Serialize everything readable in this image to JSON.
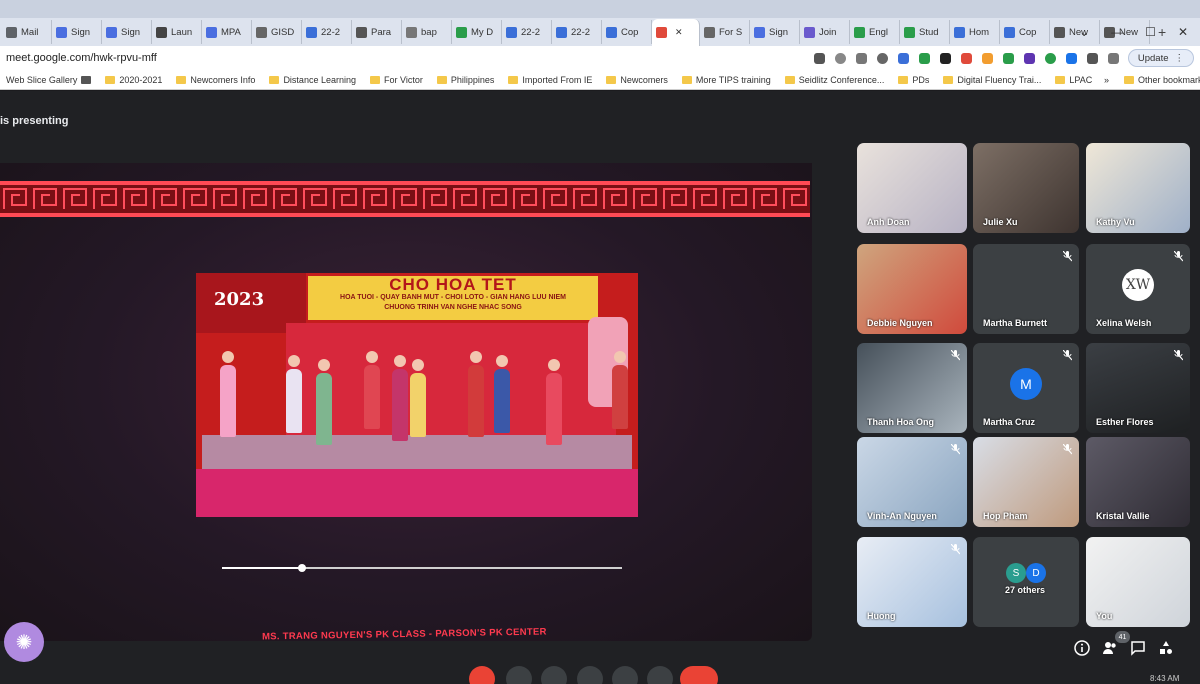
{
  "browser": {
    "tabs": [
      {
        "label": "Mail",
        "color": "#5f6368"
      },
      {
        "label": "Sign",
        "color": "#4a6ee0"
      },
      {
        "label": "Sign",
        "color": "#4a6ee0"
      },
      {
        "label": "Laun",
        "color": "#444444"
      },
      {
        "label": "MPA",
        "color": "#4a6ee0"
      },
      {
        "label": "GISD",
        "color": "#666666"
      },
      {
        "label": "22-2",
        "color": "#3b6fd8"
      },
      {
        "label": "Para",
        "color": "#555555"
      },
      {
        "label": "bap",
        "color": "#777777"
      },
      {
        "label": "My D",
        "color": "#2a9d4a"
      },
      {
        "label": "22-2",
        "color": "#3b6fd8"
      },
      {
        "label": "22-2",
        "color": "#3b6fd8"
      },
      {
        "label": "Cop",
        "color": "#3b6fd8"
      },
      {
        "label": "",
        "color": "#e04a3b"
      },
      {
        "label": "For S",
        "color": "#666666"
      },
      {
        "label": "Sign",
        "color": "#4a6ee0"
      },
      {
        "label": "Join",
        "color": "#6a5acd"
      },
      {
        "label": "Engl",
        "color": "#2a9d4a"
      },
      {
        "label": "Stud",
        "color": "#2a9d4a"
      },
      {
        "label": "Hom",
        "color": "#3b6fd8"
      },
      {
        "label": "Cop",
        "color": "#3b6fd8"
      },
      {
        "label": "New",
        "color": "#555555"
      },
      {
        "label": "New",
        "color": "#555555"
      }
    ],
    "new_tab": "+",
    "url": "meet.google.com/hwk-rpvu-mff",
    "update_label": "Update",
    "bookmarks": [
      "Web Slice Gallery",
      "2020-2021",
      "Newcomers Info",
      "Distance Learning",
      "For Victor",
      "Philippines",
      "Imported From IE",
      "Newcomers",
      "More TIPS training",
      "Seidlitz Conference...",
      "PDs",
      "Digital Fluency Trai...",
      "LPAC"
    ],
    "bookmarks_more": "»",
    "other_bookmarks": "Other bookmarks"
  },
  "meet": {
    "presenting_text": "is presenting",
    "video": {
      "banner_title": "CHO HOA TET",
      "banner_line1": "HOA TUOI - QUAY BANH MUT - CHOI LOTO - GIAN HANG LUU NIEM",
      "banner_line2": "CHUONG TRINH VAN NGHE NHAC SONG",
      "year": "2023",
      "progress": 0.2
    },
    "caption": "MS. TRANG NGUYEN'S  PK CLASS - PARSON'S PK CENTER",
    "participants": [
      {
        "name": "Anh Doan"
      },
      {
        "name": "Julie Xu"
      },
      {
        "name": "Kathy Vu"
      },
      {
        "name": "Debbie Nguyen"
      },
      {
        "name": "Martha Burnett"
      },
      {
        "name": "Xelina Welsh",
        "initials": "XW"
      },
      {
        "name": "Thanh Hoa Ong"
      },
      {
        "name": "Martha Cruz",
        "initials": "M"
      },
      {
        "name": "Esther Flores"
      },
      {
        "name": "Vinh-An Nguyen"
      },
      {
        "name": "Hop Pham"
      },
      {
        "name": "Kristal Vallie"
      },
      {
        "name": "Huong"
      },
      {
        "name": "27 others",
        "initials": [
          "S",
          "D"
        ]
      },
      {
        "name": "You"
      }
    ],
    "participant_count": "41",
    "time": "8:43 AM"
  },
  "colors": {
    "meet_bg": "#202124",
    "tile_bg": "#3c4043",
    "accent_pink": "#ff3a4f",
    "end_call": "#ea4335",
    "avatar_blue": "#1a73e8"
  }
}
